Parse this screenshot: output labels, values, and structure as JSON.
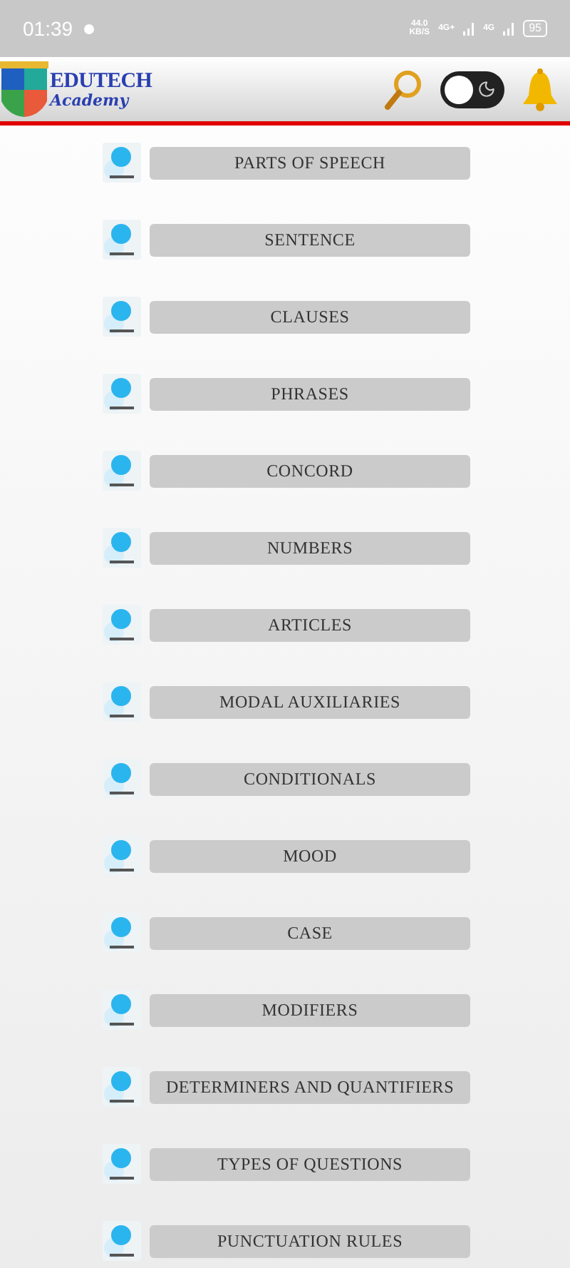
{
  "status_bar": {
    "time": "01:39",
    "speed": "44.0",
    "speed_unit": "KB/S",
    "network_1": "4G+",
    "network_2": "4G",
    "battery": "95"
  },
  "header": {
    "logo_title": "EDUTECH",
    "logo_subtitle": "Academy",
    "dark_mode_on": false
  },
  "topics": [
    {
      "label": "PARTS OF SPEECH"
    },
    {
      "label": "SENTENCE"
    },
    {
      "label": "CLAUSES"
    },
    {
      "label": "PHRASES"
    },
    {
      "label": "CONCORD"
    },
    {
      "label": "NUMBERS"
    },
    {
      "label": "ARTICLES"
    },
    {
      "label": "MODAL AUXILIARIES"
    },
    {
      "label": "CONDITIONALS"
    },
    {
      "label": "MOOD"
    },
    {
      "label": "CASE"
    },
    {
      "label": "MODIFIERS"
    },
    {
      "label": "DETERMINERS AND QUANTIFIERS"
    },
    {
      "label": "TYPES OF QUESTIONS"
    },
    {
      "label": "PUNCTUATION RULES"
    }
  ]
}
